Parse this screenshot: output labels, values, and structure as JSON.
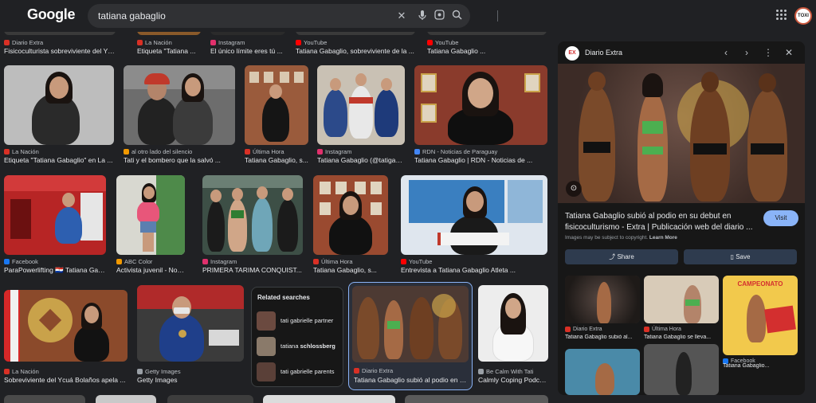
{
  "header": {
    "logo": "Google",
    "query": "tatiana gabaglio",
    "avatar_text": "TOXI"
  },
  "row0": [
    {
      "source": "Diario Extra",
      "title": "Fisicoculturista sobreviviente del Ycuá ...",
      "color": "#d93025"
    },
    {
      "source": "La Nación",
      "title": "Etiqueta \"Tatiana ...",
      "color": "#d93025"
    },
    {
      "source": "Instagram",
      "title": "El único límite eres tú ...",
      "color": "#e1306c"
    },
    {
      "source": "YouTube",
      "title": "Tatiana Gabaglio, sobreviviente de la ...",
      "color": "#ff0000"
    },
    {
      "source": "YouTube",
      "title": "Tatiana Gabaglio ...",
      "color": "#ff0000"
    }
  ],
  "row1": [
    {
      "source": "La Nación",
      "title": "Etiqueta \"Tatiana Gabaglio\" en La ...",
      "color": "#d93025"
    },
    {
      "source": "al otro lado del silencio",
      "title": "Tati y el bombero que la salvó ...",
      "color": "#f29900"
    },
    {
      "source": "Última Hora",
      "title": "Tatiana Gabaglio, s...",
      "color": "#d93025"
    },
    {
      "source": "Instagram",
      "title": "Tatiana Gabaglio (@tatigab...",
      "color": "#e1306c"
    },
    {
      "source": "RDN - Noticias de Paraguay",
      "title": "Tatiana Gabaglio | RDN - Noticias de ...",
      "color": "#4285f4"
    }
  ],
  "row2": [
    {
      "source": "Facebook",
      "title": "ParaPowerlifting 🇵🇾 Tatiana Gab...",
      "color": "#1877f2"
    },
    {
      "source": "ABC Color",
      "title": "Activista juvenil - Nosotr...",
      "color": "#f29900"
    },
    {
      "source": "Instagram",
      "title": "PRIMERA TARIMA CONQUIST...",
      "color": "#e1306c"
    },
    {
      "source": "Última Hora",
      "title": "Tatiana Gabaglio, s...",
      "color": "#d93025"
    },
    {
      "source": "YouTube",
      "title": "Entrevista a Tatiana Gabaglio Atleta ...",
      "color": "#ff0000"
    }
  ],
  "row3": [
    {
      "source": "La Nación",
      "title": "Sobreviviente del Ycuá Bolaños apela ...",
      "color": "#d93025"
    },
    {
      "source": "Getty Images",
      "title": "Getty Images",
      "color": "#9aa0a6"
    },
    {
      "source": "Diario Extra",
      "title": "Tatiana Gabaglio subió al podio en su...",
      "color": "#d93025"
    },
    {
      "source": "Be Calm With Tati",
      "title": "Calmly Coping Podcast",
      "color": "#9aa0a6"
    }
  ],
  "related": {
    "title": "Related searches",
    "items": [
      {
        "pre": "tati gabrielle partner",
        "bold": ""
      },
      {
        "pre": "tatiana ",
        "bold": "schlossberg"
      },
      {
        "pre": "tati gabrielle parents",
        "bold": ""
      }
    ]
  },
  "panel": {
    "logo": "EX",
    "source": "Diario Extra",
    "title": "Tatiana Gabaglio subió al podio en su debut en fisicoculturismo - Extra | Publicación web del diario ...",
    "visit": "Visit",
    "note": "Images may be subject to copyright.",
    "learn_more": "Learn More",
    "share": "Share",
    "save": "Save",
    "related": [
      {
        "source": "Diario Extra",
        "title": "Tatiana Gabaglio subió al...",
        "color": "#d93025"
      },
      {
        "source": "Última Hora",
        "title": "Tatiana Gabaglio se lleva...",
        "color": "#d93025"
      },
      {
        "source": "Facebook",
        "title": "Tatiana Gabaglio...",
        "color": "#1877f2"
      }
    ],
    "poster_text": "CAMPEONATO"
  }
}
